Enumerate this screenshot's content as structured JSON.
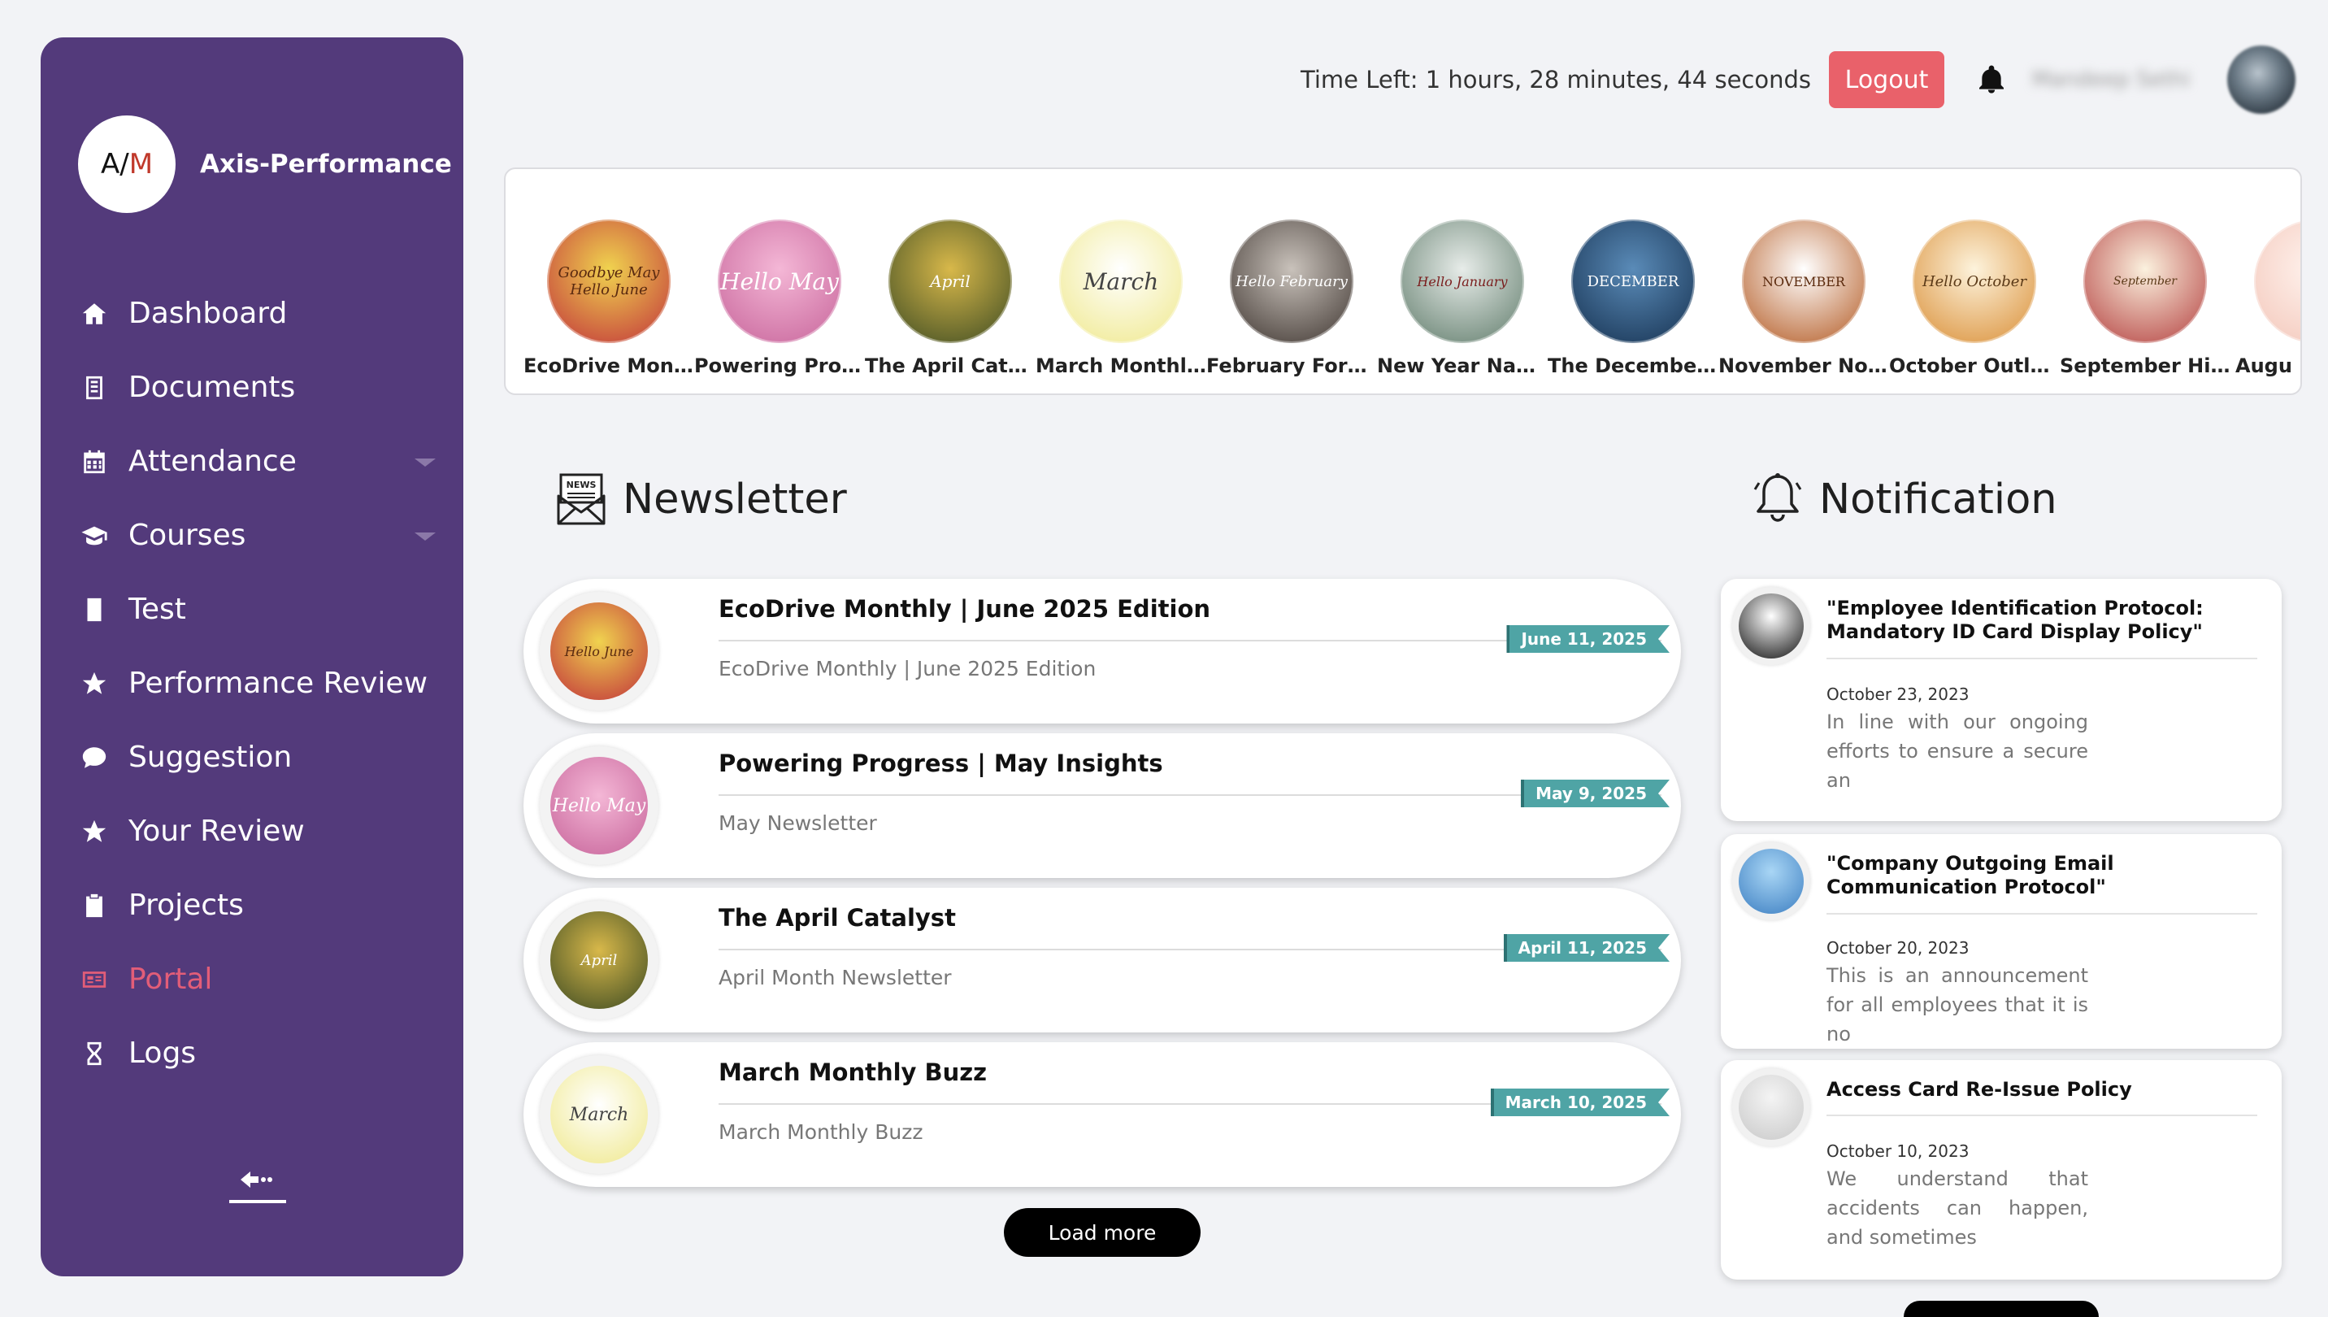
{
  "brand": {
    "logo_a": "A/",
    "logo_m": "M",
    "name": "Axis-Performance"
  },
  "nav": [
    {
      "label": "Dashboard",
      "icon": "home-icon"
    },
    {
      "label": "Documents",
      "icon": "document-icon"
    },
    {
      "label": "Attendance",
      "icon": "calendar-icon",
      "expandable": true
    },
    {
      "label": "Courses",
      "icon": "graduation-cap-icon",
      "expandable": true
    },
    {
      "label": "Test",
      "icon": "test-icon"
    },
    {
      "label": "Performance Review",
      "icon": "star-icon"
    },
    {
      "label": "Suggestion",
      "icon": "chat-icon"
    },
    {
      "label": "Your Review",
      "icon": "star-icon"
    },
    {
      "label": "Projects",
      "icon": "clipboard-icon"
    },
    {
      "label": "Portal",
      "icon": "portal-icon",
      "active": true
    },
    {
      "label": "Logs",
      "icon": "hourglass-icon"
    }
  ],
  "topbar": {
    "time_left": "Time Left: 1 hours, 28 minutes, 44 seconds",
    "logout_label": "Logout",
    "user_name": "Mandeep Sethi"
  },
  "stories": [
    {
      "label": "EcoDrive Mont...",
      "art": "Goodbye May Hello June",
      "color1": "#f0d34f",
      "color2": "#c0303a"
    },
    {
      "label": "Powering Prog...",
      "art": "Hello May",
      "color1": "#f4b7d6",
      "color2": "#c7649a"
    },
    {
      "label": "The April Catal...",
      "art": "April",
      "color1": "#d8b84a",
      "color2": "#3b4a22"
    },
    {
      "label": "March Monthl...",
      "art": "March",
      "color1": "#ffffff",
      "color2": "#efe88a"
    },
    {
      "label": "February Forw...",
      "art": "Hello February",
      "color1": "#c9c2bb",
      "color2": "#3d342f"
    },
    {
      "label": "New Year Navi...",
      "art": "Hello January",
      "color1": "#e7ece9",
      "color2": "#5f7b6a"
    },
    {
      "label": "The December ...",
      "art": "DECEMBER",
      "color1": "#5a8bb8",
      "color2": "#15304f"
    },
    {
      "label": "November Not...",
      "art": "NOVEMBER",
      "color1": "#ffffff",
      "color2": "#b2571f"
    },
    {
      "label": "October Outlo...",
      "art": "Hello October",
      "color1": "#fdf3dc",
      "color2": "#d98d34"
    },
    {
      "label": "September Hig...",
      "art": "September",
      "color1": "#fbf1de",
      "color2": "#b23c3c"
    },
    {
      "label": "Augu",
      "art": "",
      "color1": "#fff3ee",
      "color2": "#f3c6b9"
    }
  ],
  "newsletter": {
    "title": "Newsletter",
    "items": [
      {
        "title": "EcoDrive Monthly | June 2025 Edition",
        "subtitle": "EcoDrive Monthly | June 2025 Edition",
        "date": "June 11, 2025",
        "art": "Hello June",
        "color1": "#f0d34f",
        "color2": "#c0303a"
      },
      {
        "title": "Powering Progress | May Insights",
        "subtitle": "May Newsletter",
        "date": "May 9, 2025",
        "art": "Hello May",
        "color1": "#f4b7d6",
        "color2": "#c7649a"
      },
      {
        "title": "The April Catalyst",
        "subtitle": "April Month Newsletter",
        "date": "April 11, 2025",
        "art": "April",
        "color1": "#d8b84a",
        "color2": "#3b4a22"
      },
      {
        "title": "March Monthly Buzz",
        "subtitle": "March Monthly Buzz",
        "date": "March 10, 2025",
        "art": "March",
        "color1": "#ffffff",
        "color2": "#efe88a"
      }
    ],
    "load_more": "Load more"
  },
  "notifications": {
    "title": "Notification",
    "items": [
      {
        "title": "\"Employee Identification Protocol: Mandatory ID Card Display Policy\"",
        "date": "October 23, 2023",
        "body": "In line with our ongoing efforts to ensure a secure an",
        "color1": "#ffffff",
        "color2": "#111111"
      },
      {
        "title": "\"Company Outgoing Email Communication Protocol\"",
        "date": "October 20, 2023",
        "body": "This is an announcement for all employees that it is no",
        "color1": "#a9d6f5",
        "color2": "#3d7fc2"
      },
      {
        "title": "Access Card Re-Issue Policy",
        "date": "October 10, 2023",
        "body": "We understand that accidents can happen, and sometimes",
        "color1": "#f4f4f4",
        "color2": "#c9c9c9"
      }
    ]
  }
}
